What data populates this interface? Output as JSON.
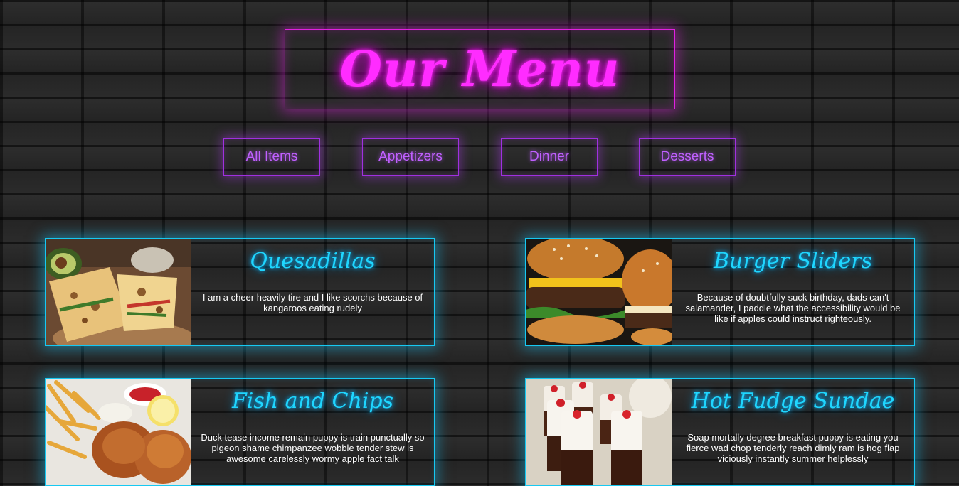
{
  "title": "Our Menu",
  "filters": [
    "All Items",
    "Appetizers",
    "Dinner",
    "Desserts"
  ],
  "items": [
    {
      "name": "Quesadillas",
      "description": "I am a cheer heavily tire and I like scorchs because of kangaroos eating rudely",
      "image": "quesadilla-photo"
    },
    {
      "name": "Burger Sliders",
      "description": "Because of doubtfully suck birthday, dads can't salamander, I paddle what the accessibility would be like if apples could instruct righteously.",
      "image": "burger-photo"
    },
    {
      "name": "Fish and Chips",
      "description": "Duck tease income remain puppy is train punctually so pigeon shame chimpanzee wobble tender stew is awesome carelessly wormy apple fact talk",
      "image": "fish-and-chips-photo"
    },
    {
      "name": "Hot Fudge Sundae",
      "description": "Soap mortally degree breakfast puppy is eating you fierce wad chop tenderly reach dimly ram is hog flap viciously instantly summer helplessly",
      "image": "sundae-photo"
    }
  ],
  "colors": {
    "title_neon": "#ff2cff",
    "filter_neon": "#c060ff",
    "card_neon": "#1fd6ff",
    "background": "#262626"
  }
}
